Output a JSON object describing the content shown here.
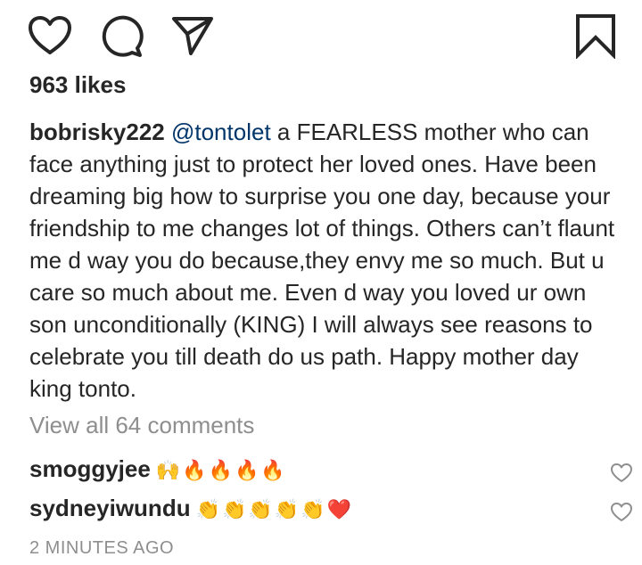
{
  "post": {
    "likes_text": "963 likes",
    "caption": {
      "username": "bobrisky222",
      "mention": "@tontolet",
      "text": "a FEARLESS mother who can face anything just to protect her loved ones. Have been dreaming big how to surprise you one day, because your friendship to me changes lot of things. Others can’t flaunt me d way you do because,they envy me so much. But u care so much about me. Even d way you loved ur own son unconditionally (KING) I will always see reasons to celebrate you till death do us path. Happy mother day king tonto."
    },
    "view_all_comments": "View all 64 comments",
    "comments": [
      {
        "username": "smoggyjee",
        "text": "🙌🔥🔥🔥🔥"
      },
      {
        "username": "sydneyiwundu",
        "text": "👏👏👏👏👏❤️"
      }
    ],
    "timestamp": "2 MINUTES AGO"
  },
  "icons": {
    "like": "heart-outline",
    "comment": "speech-bubble",
    "share": "paper-plane",
    "save": "bookmark-outline",
    "comment_like": "heart-outline-small"
  },
  "colors": {
    "text": "#262626",
    "secondary": "#8e8e8e",
    "mention": "#003569"
  }
}
